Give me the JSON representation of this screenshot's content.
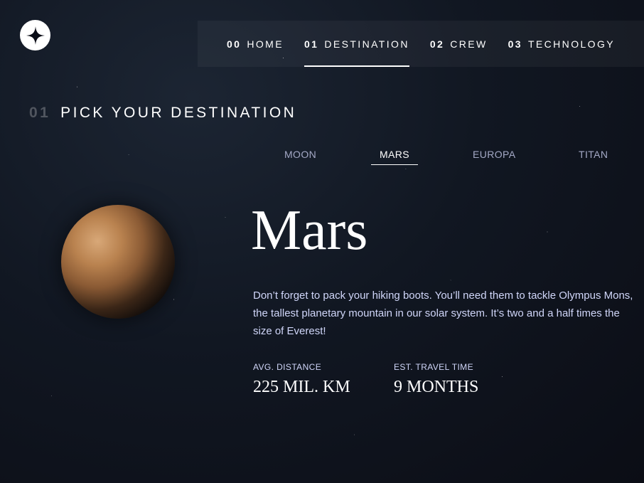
{
  "header": {
    "logo_icon": "four-point-star-icon",
    "nav": [
      {
        "number": "00",
        "label": "HOME",
        "active": false
      },
      {
        "number": "01",
        "label": "DESTINATION",
        "active": true
      },
      {
        "number": "02",
        "label": "CREW",
        "active": false
      },
      {
        "number": "03",
        "label": "TECHNOLOGY",
        "active": false
      }
    ]
  },
  "page": {
    "number": "01",
    "heading": "PICK YOUR DESTINATION"
  },
  "tabs": [
    {
      "label": "MOON",
      "active": false
    },
    {
      "label": "MARS",
      "active": true
    },
    {
      "label": "EUROPA",
      "active": false
    },
    {
      "label": "TITAN",
      "active": false
    }
  ],
  "destination": {
    "name": "Mars",
    "image_icon": "mars-planet-image",
    "description": "Don’t forget to pack your hiking boots. You’ll need them to tackle Olympus Mons, the tallest planetary mountain in our solar system. It’s two and a half times the size of Everest!",
    "distance_label": "AVG. DISTANCE",
    "distance_value": "225 MIL. KM",
    "travel_label": "EST. TRAVEL TIME",
    "travel_value": "9 MONTHS"
  },
  "colors": {
    "background": "#0b0d17",
    "text_primary": "#ffffff",
    "text_secondary": "#d0d6f9",
    "tab_inactive": "#a4a9c6"
  }
}
